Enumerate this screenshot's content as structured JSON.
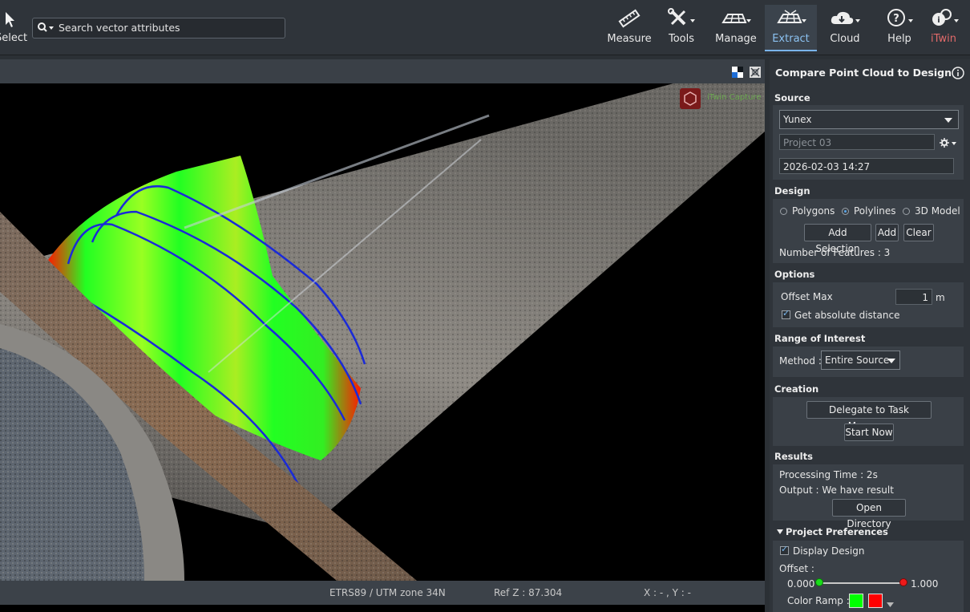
{
  "toolbar": {
    "select_label": "Select",
    "search_placeholder": "Search vector attributes",
    "buttons": [
      {
        "label": "Measure",
        "icon": "ruler-icon"
      },
      {
        "label": "Tools",
        "icon": "wrench-screwdriver-icon"
      },
      {
        "label": "Manage",
        "icon": "grid-manage-icon"
      },
      {
        "label": "Extract",
        "icon": "extract-grid-icon"
      },
      {
        "label": "Cloud",
        "icon": "cloud-icon"
      },
      {
        "label": "Help",
        "icon": "help-circle-icon"
      },
      {
        "label": "iTwin",
        "icon": "itwin-icon"
      }
    ],
    "active": "Extract"
  },
  "viewport": {
    "logo_text": "iTwin Capture",
    "status": {
      "crs": "ETRS89 / UTM zone 34N",
      "ref_z": "Ref Z : 87.304",
      "coords": "X : - , Y : -"
    }
  },
  "panel": {
    "title": "Compare Point Cloud to Design",
    "source": {
      "header": "Source",
      "selected": "Yunex",
      "project_placeholder": "Project 03",
      "datetime": "2026-02-03 14:27"
    },
    "design": {
      "header": "Design",
      "radio_polygons": "Polygons",
      "radio_polylines": "Polylines",
      "radio_3dmodel": "3D Model",
      "selected": "Polylines",
      "btn_add_selection": "Add Selection",
      "btn_add": "Add",
      "btn_clear": "Clear",
      "features": "Number of Features : 3"
    },
    "options": {
      "header": "Options",
      "offset_label": "Offset Max",
      "offset_value": "1",
      "offset_unit": "m",
      "absolute_label": "Get absolute distance",
      "absolute_checked": true
    },
    "range": {
      "header": "Range of Interest",
      "method_label": "Method :",
      "method_value": "Entire Source"
    },
    "creation": {
      "header": "Creation",
      "btn_delegate": "Delegate to Task Manager",
      "btn_start": "Start Now"
    },
    "results": {
      "header": "Results",
      "processing": "Processing Time : 2s",
      "output": "Output : We have result",
      "btn_open": "Open Directory"
    },
    "prefs": {
      "header": "Project Preferences",
      "display_design": "Display Design",
      "display_checked": true,
      "offset_label": "Offset :",
      "offset_min": "0.000",
      "offset_max": "1.000",
      "color_ramp_label": "Color Ramp :",
      "ramp_colors": [
        "#00ff00",
        "#ff0000"
      ]
    }
  }
}
